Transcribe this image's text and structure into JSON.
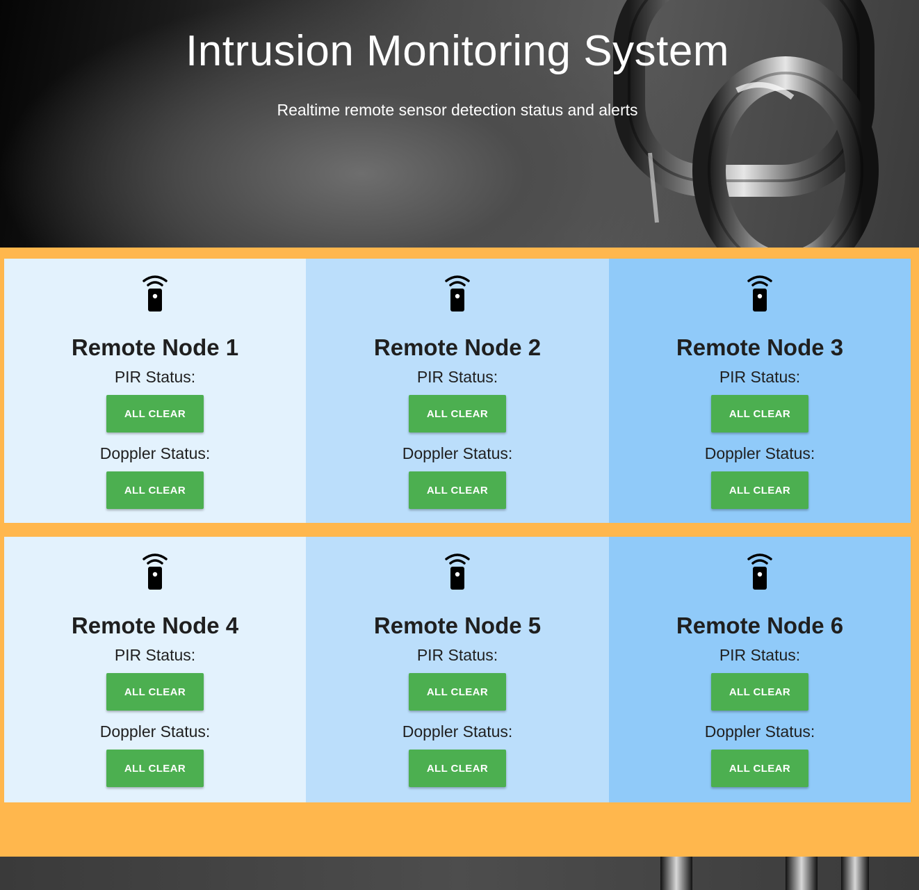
{
  "header": {
    "title": "Intrusion Monitoring System",
    "subtitle": "Realtime remote sensor detection status and alerts"
  },
  "labels": {
    "pir": "PIR Status:",
    "doppler": "Doppler Status:"
  },
  "nodes": [
    {
      "title": "Remote Node 1",
      "pir_status": "ALL CLEAR",
      "doppler_status": "ALL CLEAR"
    },
    {
      "title": "Remote Node 2",
      "pir_status": "ALL CLEAR",
      "doppler_status": "ALL CLEAR"
    },
    {
      "title": "Remote Node 3",
      "pir_status": "ALL CLEAR",
      "doppler_status": "ALL CLEAR"
    },
    {
      "title": "Remote Node 4",
      "pir_status": "ALL CLEAR",
      "doppler_status": "ALL CLEAR"
    },
    {
      "title": "Remote Node 5",
      "pir_status": "ALL CLEAR",
      "doppler_status": "ALL CLEAR"
    },
    {
      "title": "Remote Node 6",
      "pir_status": "ALL CLEAR",
      "doppler_status": "ALL CLEAR"
    }
  ],
  "icons": {
    "node": "remote-sensor-icon"
  },
  "colors": {
    "panel_background": "#ffb74d",
    "card_light": "#e3f2fd",
    "card_medium": "#bbdefb",
    "card_dark": "#90caf9",
    "status_clear": "#4caf50"
  }
}
